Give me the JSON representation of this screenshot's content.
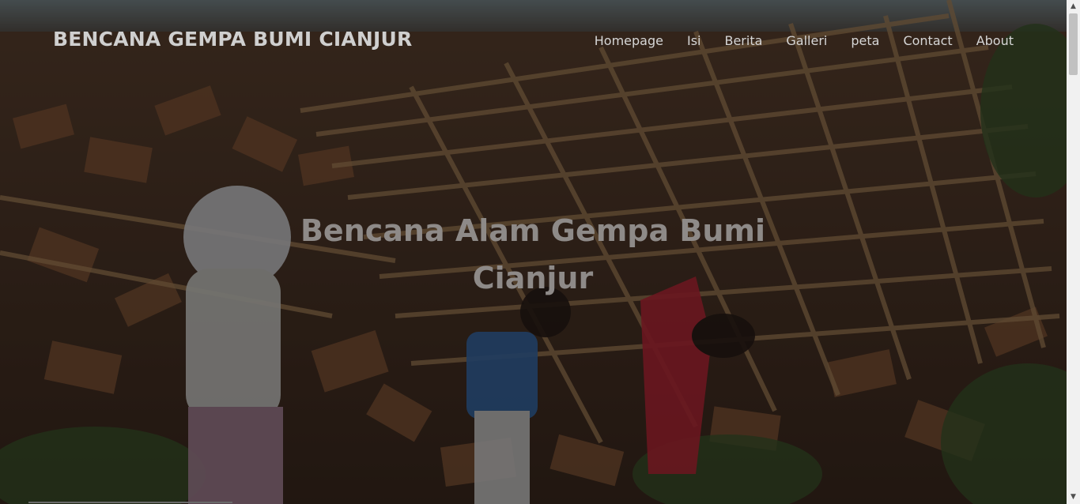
{
  "navbar": {
    "brand": "BENCANA GEMPA BUMI CIANJUR",
    "links": [
      {
        "label": "Homepage"
      },
      {
        "label": "Isi"
      },
      {
        "label": "Berita"
      },
      {
        "label": "Galleri"
      },
      {
        "label": "peta"
      },
      {
        "label": "Contact"
      },
      {
        "label": "About"
      }
    ]
  },
  "hero": {
    "title_line1": "Bencana Alam Gempa Bumi",
    "title_line2": "Cianjur",
    "overlay_color": "#000000"
  },
  "scrollbar": {
    "up_icon": "triangle-up-icon",
    "down_icon": "triangle-down-icon"
  }
}
